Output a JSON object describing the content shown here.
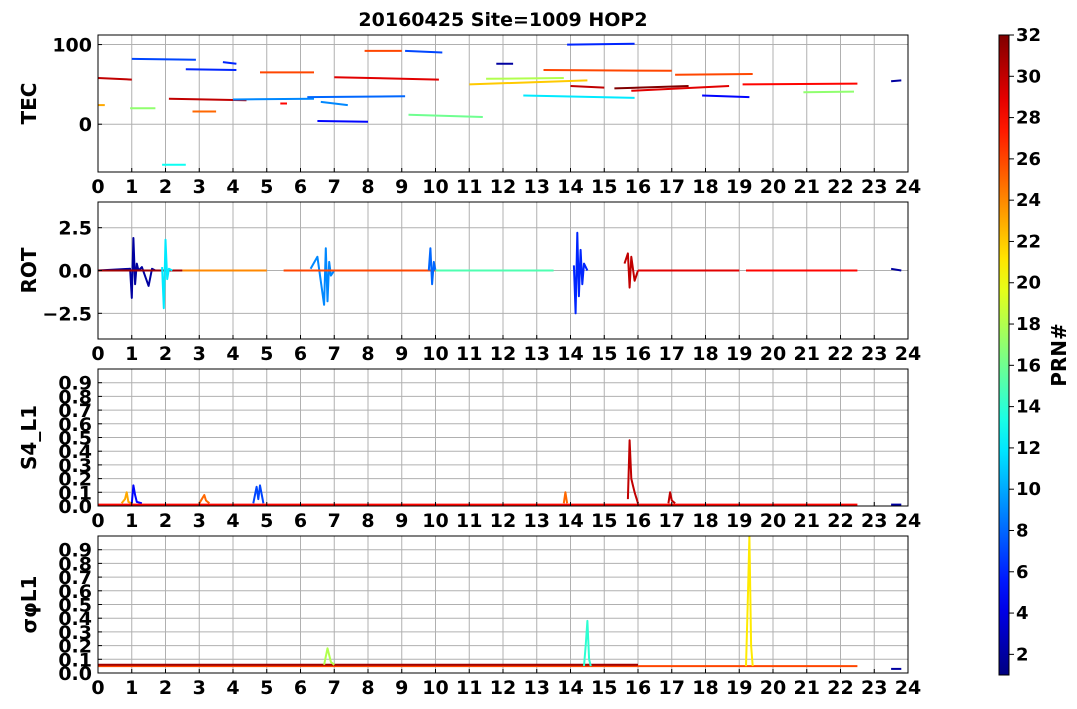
{
  "chart_data": {
    "title": "20160425 Site=1009 HOP2",
    "colorbar": {
      "label": "PRN#",
      "range": [
        1,
        32
      ],
      "ticks": [
        2,
        4,
        6,
        8,
        10,
        12,
        14,
        16,
        18,
        20,
        22,
        24,
        26,
        28,
        30,
        32
      ],
      "colormap": "jet"
    },
    "x_ticks": [
      0,
      1,
      2,
      3,
      4,
      5,
      6,
      7,
      8,
      9,
      10,
      11,
      12,
      13,
      14,
      15,
      16,
      17,
      18,
      19,
      20,
      21,
      22,
      23,
      24
    ],
    "xlim": [
      0,
      24
    ],
    "grid": true,
    "panels": [
      {
        "type": "line",
        "ylabel": "TEC",
        "ylim": [
          -60,
          112
        ],
        "y_ticks": [
          0,
          100
        ],
        "series": [
          {
            "prn": 30,
            "x": [
              0.0,
              1.0
            ],
            "y": [
              58,
              56
            ]
          },
          {
            "prn": 7,
            "x": [
              1.0,
              2.9
            ],
            "y": [
              82,
              81
            ]
          },
          {
            "prn": 17,
            "x": [
              0.95,
              1.7
            ],
            "y": [
              20,
              20
            ]
          },
          {
            "prn": 23,
            "x": [
              0.0,
              0.2
            ],
            "y": [
              24,
              24
            ]
          },
          {
            "prn": 13,
            "x": [
              1.9,
              2.6
            ],
            "y": [
              -51,
              -51
            ]
          },
          {
            "prn": 30,
            "x": [
              2.1,
              4.4
            ],
            "y": [
              32,
              30
            ]
          },
          {
            "prn": 6,
            "x": [
              2.6,
              4.1
            ],
            "y": [
              69,
              68
            ]
          },
          {
            "prn": 25,
            "x": [
              2.8,
              3.5
            ],
            "y": [
              16,
              16
            ]
          },
          {
            "prn": 6,
            "x": [
              3.7,
              4.1
            ],
            "y": [
              78,
              76
            ]
          },
          {
            "prn": 9,
            "x": [
              4.0,
              6.4
            ],
            "y": [
              31,
              32
            ]
          },
          {
            "prn": 26,
            "x": [
              4.8,
              6.4
            ],
            "y": [
              65,
              65
            ]
          },
          {
            "prn": 28,
            "x": [
              5.4,
              5.6
            ],
            "y": [
              26,
              26
            ]
          },
          {
            "prn": 8,
            "x": [
              6.2,
              9.1
            ],
            "y": [
              34,
              35
            ]
          },
          {
            "prn": 5,
            "x": [
              6.5,
              8.0
            ],
            "y": [
              4,
              3
            ]
          },
          {
            "prn": 29,
            "x": [
              7.0,
              10.1
            ],
            "y": [
              59,
              56
            ]
          },
          {
            "prn": 9,
            "x": [
              6.6,
              7.4
            ],
            "y": [
              28,
              24
            ]
          },
          {
            "prn": 26,
            "x": [
              7.9,
              9.0
            ],
            "y": [
              92,
              92
            ]
          },
          {
            "prn": 7,
            "x": [
              9.1,
              10.2
            ],
            "y": [
              92,
              90
            ]
          },
          {
            "prn": 16,
            "x": [
              9.2,
              11.4
            ],
            "y": [
              12,
              9
            ]
          },
          {
            "prn": 22,
            "x": [
              11.0,
              14.5
            ],
            "y": [
              50,
              55
            ]
          },
          {
            "prn": 18,
            "x": [
              11.5,
              13.8
            ],
            "y": [
              57,
              58
            ]
          },
          {
            "prn": 2,
            "x": [
              11.8,
              12.3
            ],
            "y": [
              76,
              76
            ]
          },
          {
            "prn": 12,
            "x": [
              12.6,
              15.9
            ],
            "y": [
              36,
              33
            ]
          },
          {
            "prn": 26,
            "x": [
              13.2,
              17.0
            ],
            "y": [
              68,
              67
            ]
          },
          {
            "prn": 30,
            "x": [
              14.0,
              15.0
            ],
            "y": [
              48,
              46
            ]
          },
          {
            "prn": 6,
            "x": [
              13.9,
              15.9
            ],
            "y": [
              100,
              101
            ]
          },
          {
            "prn": 32,
            "x": [
              15.3,
              17.5
            ],
            "y": [
              45,
              48
            ]
          },
          {
            "prn": 29,
            "x": [
              15.8,
              18.7
            ],
            "y": [
              42,
              48
            ]
          },
          {
            "prn": 26,
            "x": [
              17.1,
              19.4
            ],
            "y": [
              62,
              63
            ]
          },
          {
            "prn": 5,
            "x": [
              17.9,
              19.3
            ],
            "y": [
              36,
              34
            ]
          },
          {
            "prn": 28,
            "x": [
              19.1,
              22.5
            ],
            "y": [
              50,
              51
            ]
          },
          {
            "prn": 17,
            "x": [
              20.9,
              22.4
            ],
            "y": [
              40,
              41
            ]
          },
          {
            "prn": 2,
            "x": [
              23.5,
              23.8
            ],
            "y": [
              54,
              55
            ]
          }
        ]
      },
      {
        "type": "line",
        "ylabel": "ROT",
        "ylim": [
          -4,
          4
        ],
        "y_ticks": [
          -2.5,
          0.0,
          2.5
        ],
        "y_tick_labels": [
          "−2.5",
          "0.0",
          "2.5"
        ],
        "series": [
          {
            "prn": 2,
            "x": [
              0.0,
              0.95,
              1.0,
              1.05,
              1.1,
              1.15,
              1.2,
              1.3,
              1.5,
              1.6,
              1.7
            ],
            "y": [
              0.0,
              0.1,
              -1.6,
              1.9,
              -0.8,
              0.4,
              0.0,
              0.2,
              -0.9,
              0.1,
              0.0
            ]
          },
          {
            "prn": 31,
            "x": [
              0.0,
              2.5
            ],
            "y": [
              0.0,
              0.0
            ]
          },
          {
            "prn": 12,
            "x": [
              1.9,
              1.95,
              2.0,
              2.05,
              2.1,
              2.2
            ],
            "y": [
              0.2,
              -2.2,
              1.8,
              -0.5,
              0.1,
              0.0
            ]
          },
          {
            "prn": 24,
            "x": [
              2.5,
              5.0
            ],
            "y": [
              0.0,
              0.0
            ]
          },
          {
            "prn": 9,
            "x": [
              6.3,
              6.5,
              6.7,
              6.75,
              6.8,
              6.85,
              6.9,
              7.0
            ],
            "y": [
              0.1,
              0.8,
              -2.0,
              1.3,
              -1.8,
              0.5,
              -0.3,
              0.0
            ]
          },
          {
            "prn": 26,
            "x": [
              5.5,
              10.0
            ],
            "y": [
              0.0,
              0.0
            ]
          },
          {
            "prn": 8,
            "x": [
              9.8,
              9.85,
              9.9,
              9.95,
              10.0
            ],
            "y": [
              0.0,
              1.3,
              -0.8,
              0.5,
              0.0
            ]
          },
          {
            "prn": 15,
            "x": [
              10.0,
              13.5
            ],
            "y": [
              0.0,
              0.0
            ]
          },
          {
            "prn": 6,
            "x": [
              14.1,
              14.15,
              14.2,
              14.25,
              14.3,
              14.35,
              14.4,
              14.5
            ],
            "y": [
              0.3,
              -2.5,
              2.2,
              -1.5,
              1.2,
              -0.8,
              0.4,
              0.0
            ]
          },
          {
            "prn": 30,
            "x": [
              15.6,
              15.7,
              15.75,
              15.8,
              15.9,
              16.0
            ],
            "y": [
              0.4,
              1.0,
              -1.0,
              0.8,
              -0.6,
              0.0
            ]
          },
          {
            "prn": 29,
            "x": [
              16.0,
              19.0
            ],
            "y": [
              0.0,
              0.0
            ]
          },
          {
            "prn": 28,
            "x": [
              19.2,
              22.5
            ],
            "y": [
              0.0,
              0.0
            ]
          },
          {
            "prn": 2,
            "x": [
              23.5,
              23.8
            ],
            "y": [
              0.1,
              0.0
            ]
          }
        ]
      },
      {
        "type": "line",
        "ylabel": "S4_L1",
        "ylim": [
          0.0,
          1.0
        ],
        "y_ticks": [
          0.0,
          0.1,
          0.2,
          0.3,
          0.4,
          0.5,
          0.6,
          0.7,
          0.8,
          0.9
        ],
        "y_tick_labels": [
          "0.0",
          "0.1",
          "0.2",
          "0.3",
          "0.4",
          "0.5",
          "0.6",
          "0.7",
          "0.8",
          "0.9"
        ],
        "series": [
          {
            "prn": 23,
            "x": [
              0.7,
              0.8,
              0.85,
              0.9,
              1.0
            ],
            "y": [
              0.02,
              0.05,
              0.1,
              0.03,
              0.02
            ]
          },
          {
            "prn": 5,
            "x": [
              1.0,
              1.05,
              1.1,
              1.15,
              1.3
            ],
            "y": [
              0.02,
              0.15,
              0.08,
              0.03,
              0.02
            ]
          },
          {
            "prn": 25,
            "x": [
              3.0,
              3.1,
              3.15,
              3.2,
              3.3
            ],
            "y": [
              0.02,
              0.06,
              0.08,
              0.04,
              0.02
            ]
          },
          {
            "prn": 7,
            "x": [
              4.6,
              4.7,
              4.75,
              4.8,
              4.9
            ],
            "y": [
              0.02,
              0.14,
              0.05,
              0.15,
              0.02
            ]
          },
          {
            "prn": 25,
            "x": [
              13.8,
              13.85,
              13.9
            ],
            "y": [
              0.02,
              0.1,
              0.02
            ]
          },
          {
            "prn": 30,
            "x": [
              15.7,
              15.75,
              15.8,
              15.85,
              15.9,
              16.0
            ],
            "y": [
              0.05,
              0.48,
              0.2,
              0.15,
              0.1,
              0.02
            ]
          },
          {
            "prn": 30,
            "x": [
              16.9,
              16.95,
              17.0,
              17.1
            ],
            "y": [
              0.02,
              0.1,
              0.04,
              0.02
            ]
          },
          {
            "prn": 28,
            "x": [
              0.0,
              22.5
            ],
            "y": [
              0.01,
              0.01
            ]
          },
          {
            "prn": 2,
            "x": [
              23.5,
              23.8
            ],
            "y": [
              0.01,
              0.01
            ]
          }
        ]
      },
      {
        "type": "line",
        "ylabel": "σφL1",
        "ylim": [
          0.0,
          1.0
        ],
        "y_ticks": [
          0.0,
          0.1,
          0.2,
          0.3,
          0.4,
          0.5,
          0.6,
          0.7,
          0.8,
          0.9
        ],
        "y_tick_labels": [
          "0.0",
          "0.1",
          "0.2",
          "0.3",
          "0.4",
          "0.5",
          "0.6",
          "0.7",
          "0.8",
          "0.9"
        ],
        "series": [
          {
            "prn": 26,
            "x": [
              0.0,
              22.5
            ],
            "y": [
              0.05,
              0.05
            ]
          },
          {
            "prn": 31,
            "x": [
              0.0,
              16.0
            ],
            "y": [
              0.06,
              0.06
            ]
          },
          {
            "prn": 18,
            "x": [
              6.7,
              6.8,
              6.9,
              7.0
            ],
            "y": [
              0.06,
              0.18,
              0.08,
              0.06
            ]
          },
          {
            "prn": 14,
            "x": [
              14.4,
              14.45,
              14.5,
              14.55,
              14.6
            ],
            "y": [
              0.05,
              0.2,
              0.38,
              0.1,
              0.05
            ]
          },
          {
            "prn": 21,
            "x": [
              19.2,
              19.25,
              19.3,
              19.35,
              19.4
            ],
            "y": [
              0.05,
              0.5,
              1.0,
              0.2,
              0.05
            ]
          },
          {
            "prn": 2,
            "x": [
              23.5,
              23.8
            ],
            "y": [
              0.03,
              0.03
            ]
          }
        ]
      }
    ]
  }
}
